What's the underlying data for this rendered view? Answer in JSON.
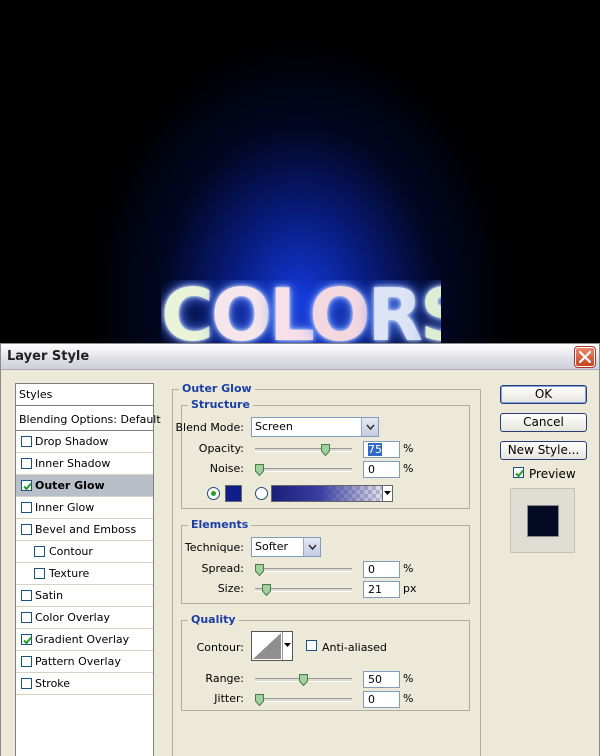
{
  "canvas": {
    "word_letters": [
      "C",
      "O",
      "L",
      "O",
      "R",
      "S"
    ]
  },
  "dialog": {
    "title": "Layer Style",
    "close_icon": "close-x-icon"
  },
  "styles_list": {
    "header": "Styles",
    "blending": "Blending Options: Default",
    "items": [
      {
        "label": "Drop Shadow",
        "checked": false,
        "indent": false,
        "selected": false
      },
      {
        "label": "Inner Shadow",
        "checked": false,
        "indent": false,
        "selected": false
      },
      {
        "label": "Outer Glow",
        "checked": true,
        "indent": false,
        "selected": true
      },
      {
        "label": "Inner Glow",
        "checked": false,
        "indent": false,
        "selected": false
      },
      {
        "label": "Bevel and Emboss",
        "checked": false,
        "indent": false,
        "selected": false
      },
      {
        "label": "Contour",
        "checked": false,
        "indent": true,
        "selected": false
      },
      {
        "label": "Texture",
        "checked": false,
        "indent": true,
        "selected": false
      },
      {
        "label": "Satin",
        "checked": false,
        "indent": false,
        "selected": false
      },
      {
        "label": "Color Overlay",
        "checked": false,
        "indent": false,
        "selected": false
      },
      {
        "label": "Gradient Overlay",
        "checked": true,
        "indent": false,
        "selected": false
      },
      {
        "label": "Pattern Overlay",
        "checked": false,
        "indent": false,
        "selected": false
      },
      {
        "label": "Stroke",
        "checked": false,
        "indent": false,
        "selected": false
      }
    ]
  },
  "outer_glow": {
    "title": "Outer Glow",
    "structure": {
      "title": "Structure",
      "blend_mode_label": "Blend Mode:",
      "blend_mode_value": "Screen",
      "opacity_label": "Opacity:",
      "opacity_value": "75",
      "opacity_unit": "%",
      "opacity_level": 0.75,
      "noise_label": "Noise:",
      "noise_value": "0",
      "noise_unit": "%",
      "noise_level": 0,
      "color_swatch": "#0e1e8a",
      "color_radio_selected": true,
      "gradient_radio_selected": false
    },
    "elements": {
      "title": "Elements",
      "technique_label": "Technique:",
      "technique_value": "Softer",
      "spread_label": "Spread:",
      "spread_value": "0",
      "spread_unit": "%",
      "spread_level": 0,
      "size_label": "Size:",
      "size_value": "21",
      "size_unit": "px",
      "size_level": 0.08
    },
    "quality": {
      "title": "Quality",
      "contour_label": "Contour:",
      "anti_aliased_label": "Anti-aliased",
      "anti_aliased_checked": false,
      "range_label": "Range:",
      "range_value": "50",
      "range_unit": "%",
      "range_level": 0.5,
      "jitter_label": "Jitter:",
      "jitter_value": "0",
      "jitter_unit": "%",
      "jitter_level": 0
    }
  },
  "buttons": {
    "ok": "OK",
    "cancel": "Cancel",
    "new_style": "New Style...",
    "preview_label": "Preview",
    "preview_checked": true,
    "preview_swatch": "#050a24"
  },
  "colors": {
    "group_title": "#1c3ea6",
    "selected_row": "#b9bfc9",
    "dialog_bg": "#ece9d8"
  }
}
